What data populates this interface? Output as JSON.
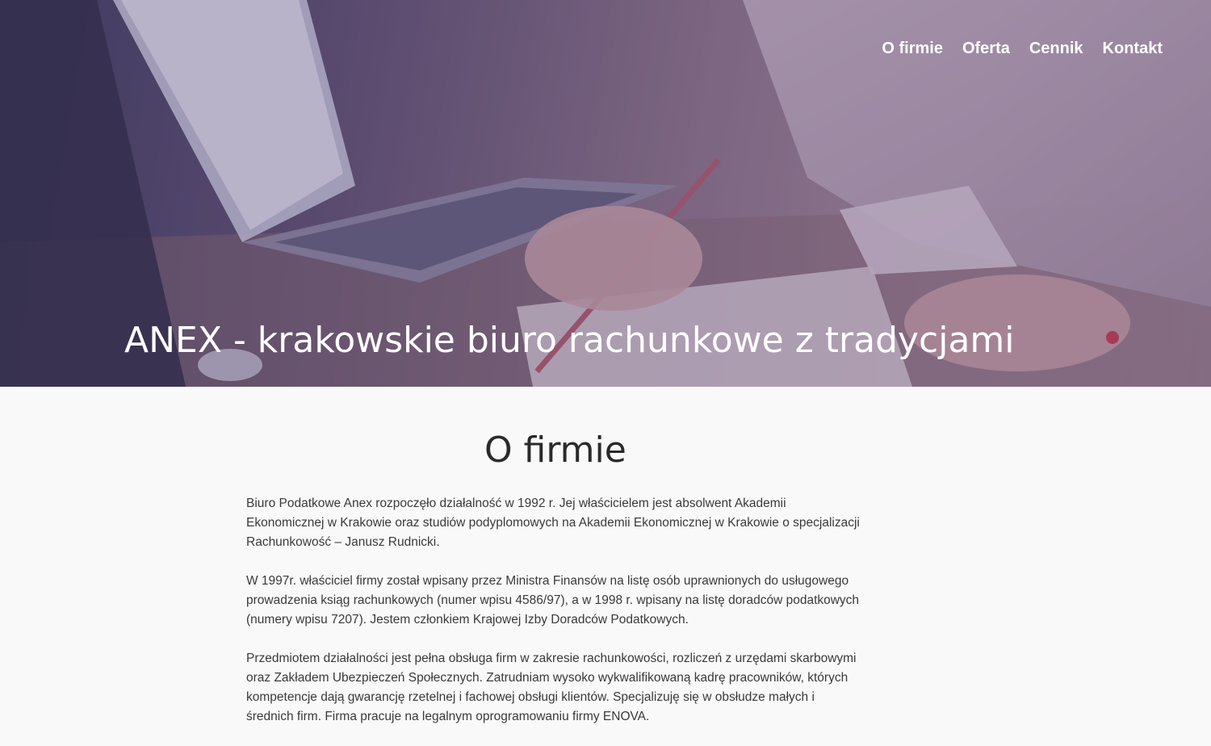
{
  "nav": {
    "items": [
      "O firmie",
      "Oferta",
      "Cennik",
      "Kontakt"
    ]
  },
  "hero": {
    "title": "ANEX - krakowskie biuro rachunkowe z tradycjami"
  },
  "about": {
    "heading": "O firmie",
    "paragraphs": [
      "Biuro Podatkowe Anex rozpoczęło działalność w 1992 r. Jej właścicielem jest absolwent Akademii Ekonomicznej w Krakowie oraz studiów podyplomowych na Akademii Ekonomicznej w Krakowie o specjalizacji Rachunkowość – Janusz Rudnicki.",
      "W 1997r. właściciel firmy został wpisany przez Ministra Finansów na listę osób uprawnionych do usługowego prowadzenia ksiąg rachunkowych (numer wpisu 4586/97), a w 1998 r. wpisany na listę doradców podatkowych (numery wpisu 7207). Jestem członkiem Krajowej Izby Doradców Podatkowych.",
      "Przedmiotem działalności jest pełna obsługa firm w zakresie rachunkowości, rozliczeń z urzędami skarbowymi oraz Zakładem Ubezpieczeń Społecznych. Zatrudniam wysoko wykwalifikowaną kadrę pracowników, których kompetencje dają gwarancję rzetelnej i fachowej obsługi klientów. Specjalizuję się w obsłudze małych i średnich firm. Firma pracuje na legalnym oprogramowaniu firmy ENOVA."
    ]
  },
  "colors": {
    "hero_overlay": "#5e4f70",
    "text": "#3a3a3a",
    "heading": "#2a2a2a",
    "background": "#f9f9f9"
  }
}
